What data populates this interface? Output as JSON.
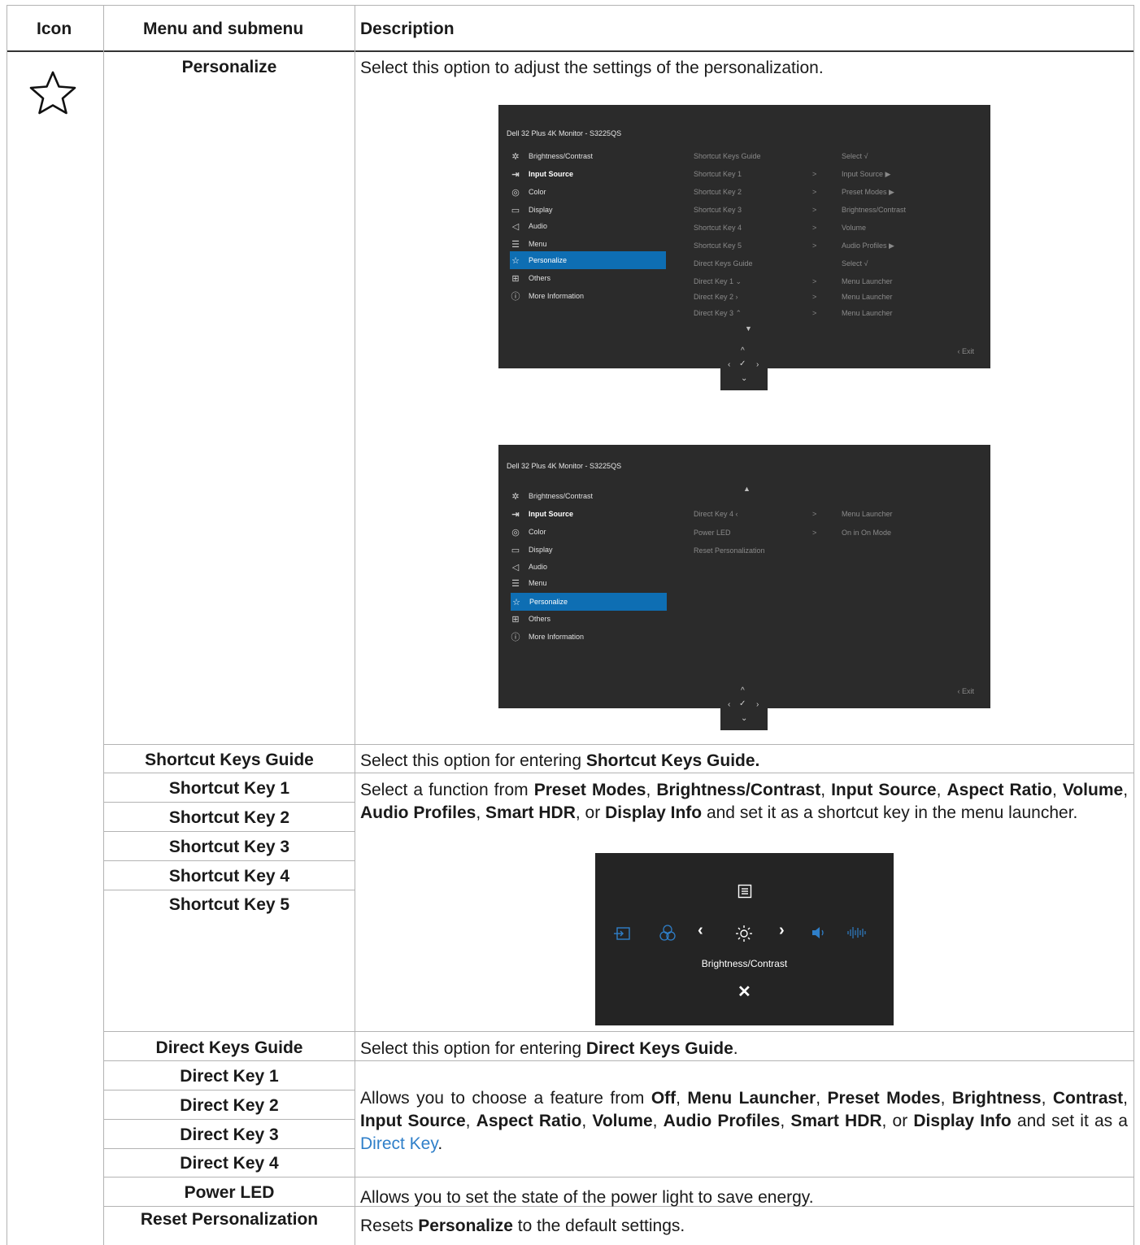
{
  "headers": {
    "icon": "Icon",
    "menu": "Menu and submenu",
    "description": "Description"
  },
  "rows": {
    "personalize": {
      "name": "Personalize",
      "desc": "Select this option to adjust the settings of the personalization."
    },
    "shortcut_guide": {
      "name": "Shortcut Keys Guide",
      "desc_pre": "Select this option for entering ",
      "desc_bold": "Shortcut Keys Guide."
    },
    "shortcut_keys": [
      "Shortcut Key 1",
      "Shortcut Key 2",
      "Shortcut Key 3",
      "Shortcut Key 4",
      "Shortcut Key 5"
    ],
    "shortcut_desc": {
      "p1": "Select a function from ",
      "b1": "Preset Modes",
      "s1": ", ",
      "b2": "Brightness/Contrast",
      "s2": ", ",
      "b3": "Input Source",
      "s3": ", ",
      "b4": "Aspect Ratio",
      "s4": ", ",
      "b5": "Volume",
      "s5": ", ",
      "b6": "Audio Profiles",
      "s6": ", ",
      "b7": "Smart HDR",
      "s7": ", or ",
      "b8": "Display Info",
      "p2": " and set it as a shortcut key in the menu launcher."
    },
    "direct_guide": {
      "name": "Direct Keys Guide",
      "desc_pre": "Select this option for entering ",
      "desc_bold": "Direct Keys Guide",
      "desc_post": "."
    },
    "direct_keys": [
      "Direct Key 1",
      "Direct Key 2",
      "Direct Key 3",
      "Direct Key 4"
    ],
    "direct_desc": {
      "p1": "Allows you to choose a feature from ",
      "b1": "Off",
      "s1": ", ",
      "b2": "Menu Launcher",
      "s2": ", ",
      "b3": "Preset Modes",
      "s3": ", ",
      "b4": "Brightness",
      "s4": ", ",
      "b5": "Contrast",
      "s5": ", ",
      "b6": "Input Source",
      "s6": ", ",
      "b7": "Aspect Ratio",
      "s7": ", ",
      "b8": "Volume",
      "s8": ", ",
      "b9": "Audio Profiles",
      "s9": ", ",
      "b10": "Smart HDR",
      "s10": ", or ",
      "b11": "Display Info",
      "p2": " and set it as a ",
      "link": "Direct Key",
      "p3": "."
    },
    "power_led": {
      "name": "Power LED",
      "desc": "Allows you to set the state of the power light to save energy."
    },
    "reset": {
      "name": "Reset Personalization",
      "desc_pre": "Resets ",
      "desc_bold": "Personalize",
      "desc_post": " to the default settings."
    }
  },
  "osd": {
    "title": "Dell 32 Plus 4K Monitor - S3225QS",
    "menu": [
      "Brightness/Contrast",
      "Input Source",
      "Color",
      "Display",
      "Audio",
      "Menu",
      "Personalize",
      "Others",
      "More Information"
    ],
    "screen1": {
      "rows": [
        {
          "label": "Shortcut Keys Guide",
          "arrow": "",
          "value": "Select √"
        },
        {
          "label": "Shortcut Key 1",
          "arrow": ">",
          "value": "Input Source  ▶"
        },
        {
          "label": "Shortcut Key 2",
          "arrow": ">",
          "value": "Preset Modes  ▶"
        },
        {
          "label": "Shortcut Key 3",
          "arrow": ">",
          "value": "Brightness/Contrast"
        },
        {
          "label": "Shortcut Key 4",
          "arrow": ">",
          "value": "Volume"
        },
        {
          "label": "Shortcut Key 5",
          "arrow": ">",
          "value": "Audio Profiles ▶"
        },
        {
          "label": "Direct Keys Guide",
          "arrow": "",
          "value": "Select √"
        },
        {
          "label": "Direct Key 1 ⌄",
          "arrow": ">",
          "value": "Menu Launcher"
        },
        {
          "label": "Direct Key 2 ›",
          "arrow": ">",
          "value": "Menu Launcher"
        },
        {
          "label": "Direct Key 3 ⌃",
          "arrow": ">",
          "value": "Menu Launcher"
        }
      ]
    },
    "screen2": {
      "rows": [
        {
          "label": "Direct Key 4 ‹",
          "arrow": ">",
          "value": "Menu Launcher"
        },
        {
          "label": "Power LED",
          "arrow": ">",
          "value": "On in On Mode"
        },
        {
          "label": "Reset Personalization",
          "arrow": "",
          "value": ""
        }
      ]
    },
    "exit": "‹ Exit"
  },
  "launcher": {
    "label": "Brightness/Contrast"
  }
}
